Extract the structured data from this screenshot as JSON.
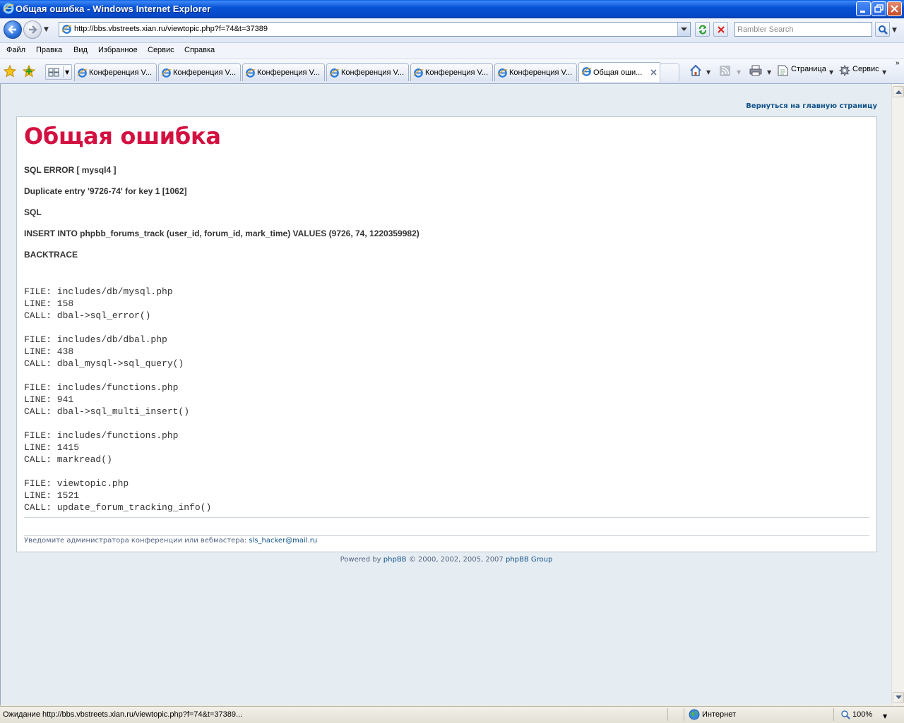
{
  "window": {
    "title": "Общая ошибка - Windows Internet Explorer"
  },
  "address_bar": {
    "url": "http://bbs.vbstreets.xian.ru/viewtopic.php?f=74&t=37389",
    "search_placeholder": "Rambler Search"
  },
  "menu": {
    "items": [
      "Файл",
      "Правка",
      "Вид",
      "Избранное",
      "Сервис",
      "Справка"
    ]
  },
  "tabs": [
    {
      "label": "Конференция V...",
      "active": false
    },
    {
      "label": "Конференция V...",
      "active": false
    },
    {
      "label": "Конференция V...",
      "active": false
    },
    {
      "label": "Конференция V...",
      "active": false
    },
    {
      "label": "Конференция V...",
      "active": false
    },
    {
      "label": "Конференция V...",
      "active": false
    },
    {
      "label": "Общая оши...",
      "active": true
    }
  ],
  "command_bar": {
    "page_label": "Страница",
    "tools_label": "Сервис"
  },
  "page": {
    "return_link": "Вернуться на главную страницу",
    "heading": "Общая ошибка",
    "messages": [
      "SQL ERROR [ mysql4 ]",
      "Duplicate entry '9726-74' for key 1 [1062]",
      "SQL",
      "INSERT INTO phpbb_forums_track (user_id, forum_id, mark_time) VALUES (9726, 74, 1220359982)",
      "BACKTRACE"
    ],
    "backtrace": [
      "FILE: includes/db/mysql.php",
      "LINE: 158",
      "CALL: dbal->sql_error()",
      "",
      "FILE: includes/db/dbal.php",
      "LINE: 438",
      "CALL: dbal_mysql->sql_query()",
      "",
      "FILE: includes/functions.php",
      "LINE: 941",
      "CALL: dbal->sql_multi_insert()",
      "",
      "FILE: includes/functions.php",
      "LINE: 1415",
      "CALL: markread()",
      "",
      "FILE: viewtopic.php",
      "LINE: 1521",
      "CALL: update_forum_tracking_info()"
    ],
    "notify_text": "Уведомите администратора конференции или вебмастера:",
    "notify_email": "sls_hacker@mail.ru",
    "powered_prefix": "Powered by",
    "powered_link1": "phpBB",
    "powered_middle": "© 2000, 2002, 2005, 2007",
    "powered_link2": "phpBB Group"
  },
  "status_bar": {
    "text": "Ожидание http://bbs.vbstreets.xian.ru/viewtopic.php?f=74&t=37389...",
    "zone": "Интернет",
    "zoom": "100%"
  },
  "colors": {
    "heading": "#d31141",
    "link": "#105289",
    "page_bg": "#e6edf2",
    "title_bar": "#0853d6"
  }
}
